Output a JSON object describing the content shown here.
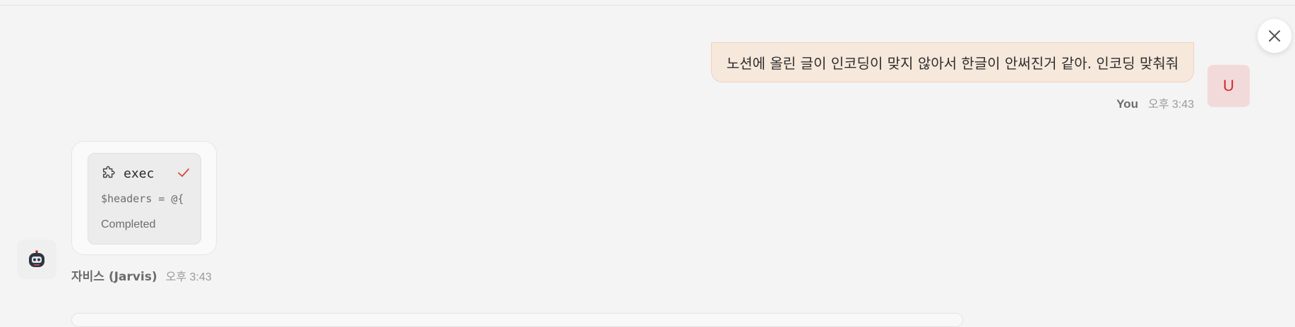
{
  "close": {
    "icon": "close-icon"
  },
  "user_message": {
    "text": "노션에 올린 글이 인코딩이 맞지 않아서 한글이 안써진거 같아. 인코딩 맞춰줘",
    "author": "You",
    "time": "오후 3:43",
    "avatar_letter": "U"
  },
  "assistant_message": {
    "tool": {
      "icon": "puzzle-icon",
      "name": "exec",
      "status_icon": "check-icon",
      "code": "$headers = @{",
      "status": "Completed"
    },
    "author": "자비스 (Jarvis)",
    "time": "오후 3:43",
    "avatar_icon": "robot-icon"
  },
  "colors": {
    "user_bubble": "#f7e8dc",
    "user_avatar_bg": "#f3dada",
    "user_avatar_text": "#cf2b2b",
    "check": "#d24b3e"
  }
}
